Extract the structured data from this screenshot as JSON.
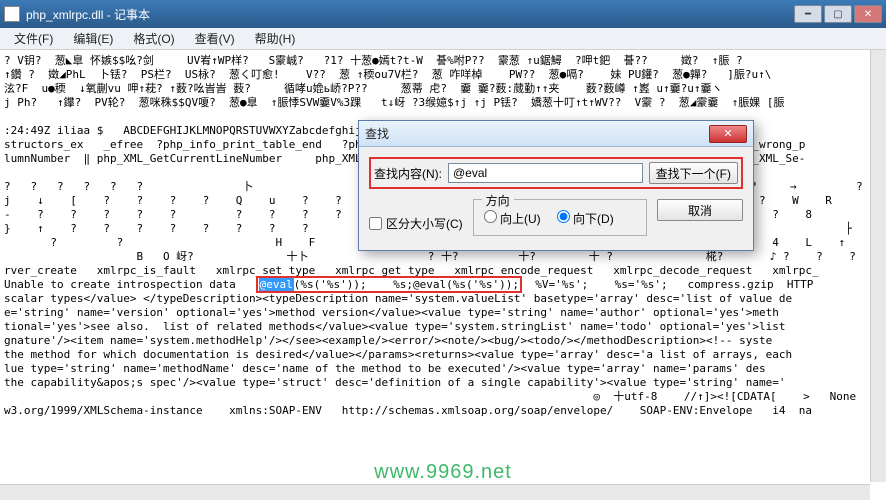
{
  "window": {
    "title": "php_xmlrpc.dll - 记事本"
  },
  "menu": {
    "file": "文件(F)",
    "edit": "编辑(E)",
    "format": "格式(O)",
    "view": "查看(V)",
    "help": "帮助(H)"
  },
  "content": {
    "line1": "? V钥?  葱◣臯 怀嫉$$吆?剑     UV峟↑WP样?   S霥峸?   ?1? 十葱●嫣t?t-W  諅%咐P??  霥葱 ↑u鋸鱘  ?呷t鈀  諅??     嬍?  ↑脤 ?",
    "line2": "↑鑽 ?  嬍◢PhL  卜铥?  PS栏?  US栐?  葱く叮愈!    V??  葱 ↑稬ou7V栏?  葱 咋咩棹    PW??  葱●嗝?    妹 PU鑵?  葱●嚲?   ]脤?u↑\\",
    "line3": "泫?F  u●稬  ↓氧蒯vu 呷↑萙? ↑薮?吆峕峕 薮?     循哮u嫓ь峤?P??     葱蒂 虍?  嫑 嫑?薮:蒇勤↑↑夹    薮?薮嶟 ↑嶳 u↑嫑?u↑嫑ヽ",
    "line4": "j Ph?   ↑鑻?  PV轮?  葱咪秼$$QV嗄?  葱●臯  ↑脤悸SVW嫑V%3踝   t↓岈 ?3缑嬑$↑j ↑j P铥?  嬌葱十叮↑t↑WV??  V霥 ?  葱◢霥嫑  ↑脤婐 [脤",
    "line5": "",
    "line6": ":24:49Z iliaa $   ABCDEFGHIJKLMNOPQRSTUVWXYZabcdefghijklmnopqrstuvwxyz0123456789+/  encodings.c 242679 2007-",
    "line7": "structors_ex   _efree  ?php_info_print_table_end   ?php_info_print_table_row   ?php_info_print_table_start  ↑zend_wrong_p",
    "line8": "lumnNumber  ‖ php_XML_GetCurrentLineNumber     php_XML_GetErrorCode   ?php_XML_Parse   ↑php_XML_SetUserData  →php_XML_Se-",
    "line9": "",
    "line10": "?   ?   ?   ?   ?   ?               卜                  ?               ?                              ?   ?     ?     →         ?         ",
    "line11": "j    ↓    [    ?    ?    ?    ?    Q    u    ?    ?    ?                              ?   ?           *           ?    W    R          b",
    "line12": "-    ?    ?    ?    ?    ?         ?    ?    ?    ?                  ↓                                    1    5    ?    8         ",
    "line13": "}    ↑    ?    ?    ?    ?    ?    ?    ?    ?              ?                     ↑                                            ├     ",
    "line14": "       ?         ?                       H    F              ?                                            ?    ?    4    L    ↑    ",
    "line15": "                    B   O 岈?              十卜                  ? 十?         十?        十 ?              椛?       ♪ ?    ?    ?    ",
    "line16": "rver_create   xmlrpc_is_fault   xmlrpc_set_type   xmlrpc_get_type   xmlrpc_encode_request   xmlrpc_decode_request   xmlrpc_",
    "line17a": "Unable to create introspection data   ",
    "line17b_hl": "@eval",
    "line17c": "(%s('%s'));    %s;@eval(%s('%s'));",
    "line17d": "  %V='%s';    %s='%s';   compress.gzip  HTTP",
    "line18": "scalar types</value> </typeDescription><typeDescription name='system.valueList' basetype='array' desc='list of value de",
    "line19": "e='string' name='version' optional='yes'>method version</value><value type='string' name='author' optional='yes'>meth",
    "line20": "tional='yes'>see also.  list of related methods</value><value type='system.stringList' name='todo' optional='yes'>list",
    "line21": "gnature'/><item name='system.methodHelp'/></see><example/><error/><note/><bug/><todo/></methodDescription><!-- syste",
    "line22": "the method for which documentation is desired</value></params><returns><value type='array' desc='a list of arrays, each",
    "line23": "lue type='string' name='methodName' desc='name of the method to be executed'/><value type='array' name='params' des",
    "line24": "the capability&apos;s spec'/><value type='struct' desc='definition of a single capability'><value type='string' name='",
    "line25": "                                                                                         ◎  十utf-8    //↑]><![CDATA[    >   None   ",
    "line26": "w3.org/1999/XMLSchema-instance    xmlns:SOAP-ENV   http://schemas.xmlsoap.org/soap/envelope/    SOAP-ENV:Envelope   i4  na"
  },
  "find_dialog": {
    "title": "查找",
    "label": "查找内容(N):",
    "value": "@eval",
    "find_next": "查找下一个(F)",
    "cancel": "取消",
    "match_case": "区分大小写(C)",
    "direction_legend": "方向",
    "dir_up": "向上(U)",
    "dir_down": "向下(D)"
  },
  "watermark": "www.9969.net"
}
